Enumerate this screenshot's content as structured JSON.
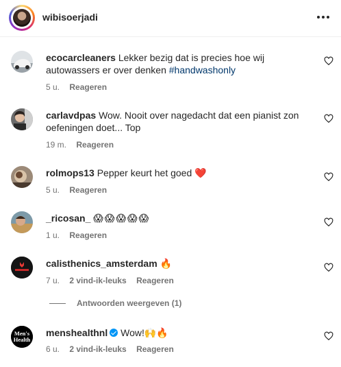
{
  "post": {
    "owner_username": "wibisoerjadi",
    "more_icon": "more-horizontal-icon"
  },
  "comments": [
    {
      "username": "ecocarcleaners",
      "text": "Lekker bezig dat is precies hoe wij autowassers er over denken ",
      "hashtag": "#handwashonly",
      "time": "5 u.",
      "reply_label": "Reageren"
    },
    {
      "username": "carlavdpas",
      "text": "Wow. Nooit over nagedacht dat een pianist zon oefeningen doet... Top",
      "time": "19 m.",
      "reply_label": "Reageren"
    },
    {
      "username": "rolmops13",
      "text": "Pepper keurt het goed ",
      "emoji": "❤️",
      "time": "5 u.",
      "reply_label": "Reageren"
    },
    {
      "username": "_ricosan_",
      "emoji": "😱😱😱😱😱",
      "time": "1 u.",
      "reply_label": "Reageren"
    },
    {
      "username": "calisthenics_amsterdam",
      "emoji": "🔥",
      "time": "7 u.",
      "likes": "2 vind-ik-leuks",
      "reply_label": "Reageren"
    },
    {
      "username": "menshealthnl",
      "verified": true,
      "text": "Wow!",
      "emoji": "🙌🔥",
      "time": "6 u.",
      "likes": "2 vind-ik-leuks",
      "reply_label": "Reageren"
    }
  ],
  "view_replies_label": "Antwoorden weergeven (1)",
  "avatar_logo_text": {
    "calisthenics": "CALISTHENICS",
    "menshealth": "Men's Health"
  },
  "colors": {
    "hashtag": "#00376b",
    "meta_text": "#737373",
    "verified_badge": "#0095f6",
    "heart_emoji": "#e0245e"
  }
}
